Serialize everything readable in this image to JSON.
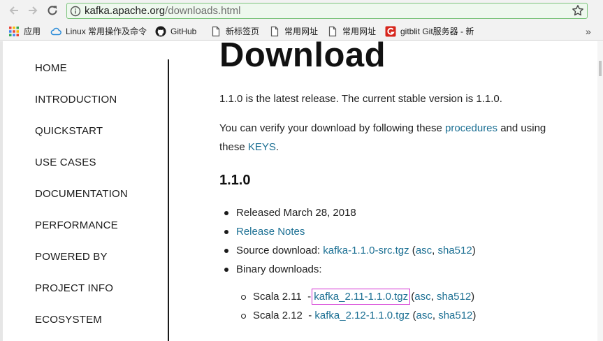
{
  "browser": {
    "url_host": "kafka.apache.org",
    "url_path": "/downloads.html"
  },
  "bookmarks": [
    {
      "label": "应用",
      "icon": "apps-grid-icon"
    },
    {
      "label": "Linux 常用操作及命令",
      "icon": "cloud-icon"
    },
    {
      "label": "GitHub",
      "icon": "github-icon"
    },
    {
      "label": "新标签页",
      "icon": "page-icon"
    },
    {
      "label": "常用网址",
      "icon": "page-icon"
    },
    {
      "label": "常用网址",
      "icon": "page-icon"
    },
    {
      "label": "gitblit Git服务器 - 新",
      "icon": "gitblit-icon"
    }
  ],
  "bookmarks_more": "»",
  "sidebar": {
    "items": [
      {
        "label": "HOME"
      },
      {
        "label": "INTRODUCTION"
      },
      {
        "label": "QUICKSTART"
      },
      {
        "label": "USE CASES"
      },
      {
        "label": "DOCUMENTATION"
      },
      {
        "label": "PERFORMANCE"
      },
      {
        "label": "POWERED BY"
      },
      {
        "label": "PROJECT INFO"
      },
      {
        "label": "ECOSYSTEM"
      }
    ]
  },
  "main": {
    "title": "Download",
    "latest_release": "1.1.0 is the latest release. The current stable version is 1.1.0.",
    "verify_prefix": "You can verify your download by following these ",
    "verify_link1": "procedures",
    "verify_mid": " and using",
    "verify_line2_prefix": "these ",
    "verify_link2": "KEYS",
    "verify_suffix": ".",
    "version_heading": "1.1.0",
    "released": "Released March 28, 2018",
    "release_notes": "Release Notes",
    "source_prefix": "Source download: ",
    "source_file": "kafka-1.1.0-src.tgz",
    "open_paren": " (",
    "asc": "asc",
    "comma": ", ",
    "sha512": "sha512",
    "close_paren": ")",
    "binary_label": "Binary downloads:",
    "scala_211_label": "Scala 2.11",
    "scala_211_file": "kafka_2.11-1.1.0.tgz",
    "scala_212_label": "Scala 2.12",
    "scala_212_file": "kafka_2.12-1.1.0.tgz",
    "dash": "  - "
  },
  "colors": {
    "link": "#1b6f93",
    "highlight": "#d22fd2",
    "urlbar_border": "#7bc47b"
  }
}
